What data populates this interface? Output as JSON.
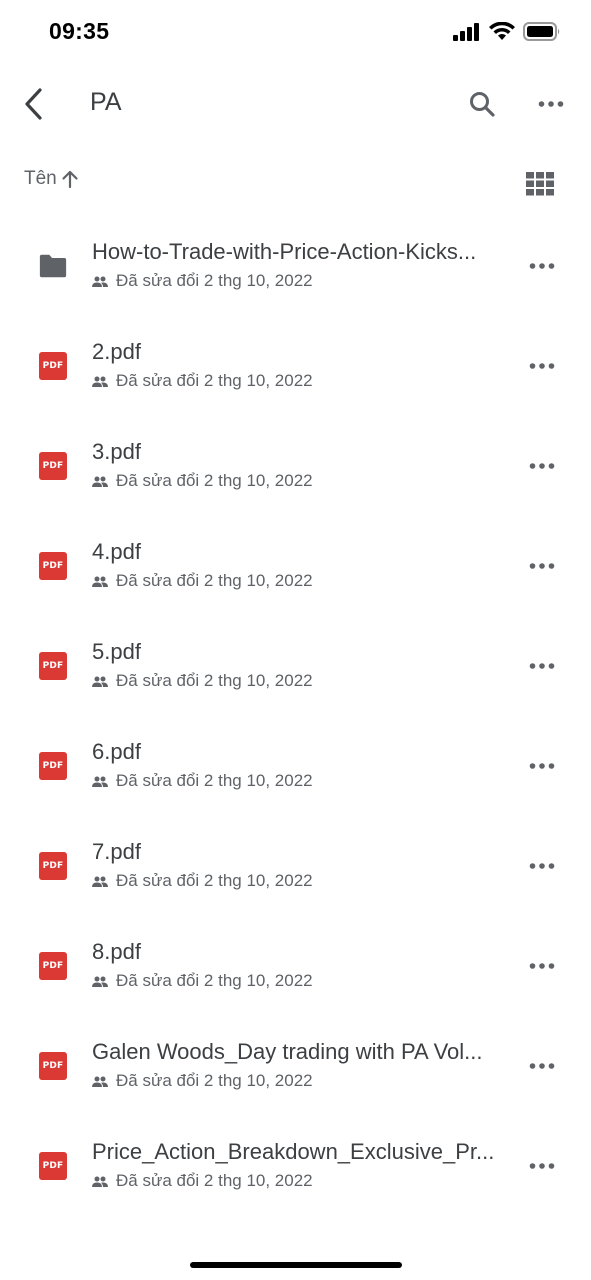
{
  "status_bar": {
    "time": "09:35",
    "icons": [
      "cellular-signal-icon",
      "wifi-icon",
      "battery-icon"
    ]
  },
  "app_bar": {
    "back_icon": "chevron-left-icon",
    "title": "PA",
    "search_icon": "search-icon",
    "more_icon": "more-horizontal-icon"
  },
  "sort_bar": {
    "label": "Tên",
    "direction_icon": "arrow-up-icon",
    "view_icon": "grid-view-icon"
  },
  "colors": {
    "pdf_red": "#db3a34",
    "folder_gray": "#5f6368",
    "text_primary": "#3c4043",
    "text_secondary": "#5f6368"
  },
  "files": [
    {
      "name": "How-to-Trade-with-Price-Action-Kicks...",
      "type": "folder",
      "meta": "Đã sửa đổi 2 thg 10, 2022"
    },
    {
      "name": "2.pdf",
      "type": "pdf",
      "meta": "Đã sửa đổi 2 thg 10, 2022"
    },
    {
      "name": "3.pdf",
      "type": "pdf",
      "meta": "Đã sửa đổi 2 thg 10, 2022"
    },
    {
      "name": "4.pdf",
      "type": "pdf",
      "meta": "Đã sửa đổi 2 thg 10, 2022"
    },
    {
      "name": "5.pdf",
      "type": "pdf",
      "meta": "Đã sửa đổi 2 thg 10, 2022"
    },
    {
      "name": "6.pdf",
      "type": "pdf",
      "meta": "Đã sửa đổi 2 thg 10, 2022"
    },
    {
      "name": "7.pdf",
      "type": "pdf",
      "meta": "Đã sửa đổi 2 thg 10, 2022"
    },
    {
      "name": "8.pdf",
      "type": "pdf",
      "meta": "Đã sửa đổi 2 thg 10, 2022"
    },
    {
      "name": "Galen Woods_Day trading with PA Vol...",
      "type": "pdf",
      "meta": "Đã sửa đổi 2 thg 10, 2022"
    },
    {
      "name": "Price_Action_Breakdown_Exclusive_Pr...",
      "type": "pdf",
      "meta": "Đã sửa đổi 2 thg 10, 2022"
    }
  ],
  "pdf_badge_label": "PDF"
}
